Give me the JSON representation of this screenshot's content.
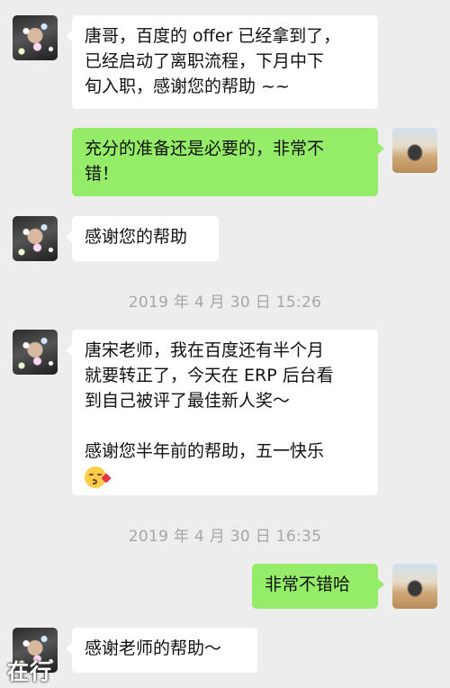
{
  "timestamps": [
    "2019 年 4 月 30 日  15:26",
    "2019 年 4 月 30 日  16:35"
  ],
  "messages": [
    {
      "lines": [
        "唐哥，百度的 offer 已经拿到了，",
        "已经启动了离职流程，下月中下",
        "旬入职，感谢您的帮助 ~~"
      ]
    },
    {
      "lines": [
        "充分的准备还是必要的，非常不",
        "错！"
      ]
    },
    {
      "lines": [
        "感谢您的帮助"
      ]
    },
    {
      "lines": [
        "唐宋老师，我在百度还有半个月",
        "就要转正了，今天在 ERP 后台看",
        "到自己被评了最佳新人奖～",
        "感谢您半年前的帮助，五一快乐"
      ]
    },
    {
      "lines": [
        "非常不错哈"
      ]
    },
    {
      "lines": [
        "感谢老师的帮助～"
      ]
    }
  ],
  "icons": {
    "contact_avatar": "contact-avatar",
    "self_avatar": "self-avatar",
    "emoji": "kissing-face-emoji"
  },
  "colors": {
    "background": "#ededed",
    "incoming_bubble": "#ffffff",
    "outgoing_bubble": "#95ec69",
    "timestamp": "#a6a6a6"
  },
  "watermark": "在行"
}
